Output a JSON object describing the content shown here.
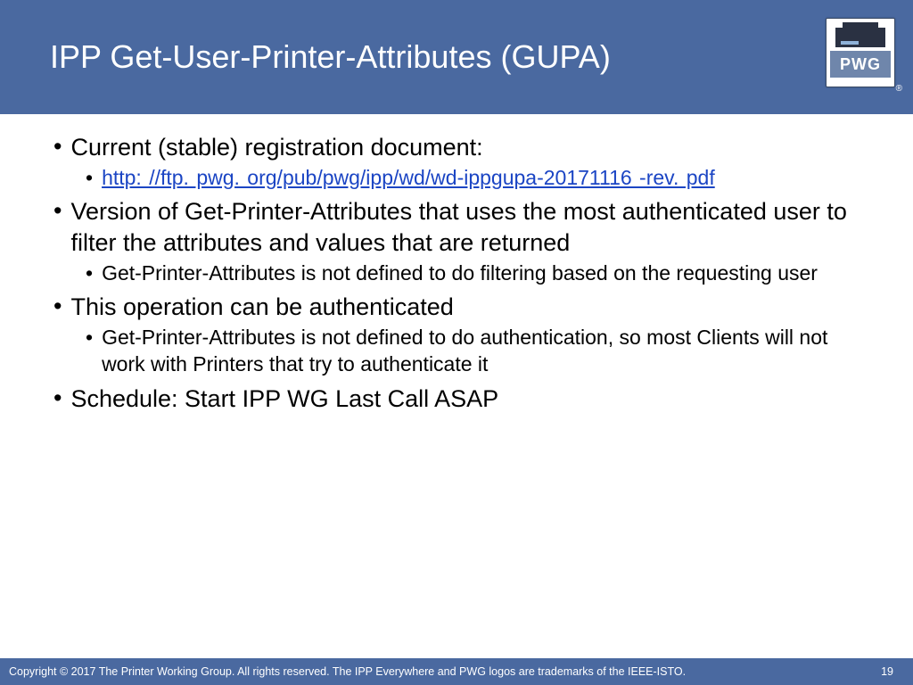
{
  "header": {
    "title": "IPP Get-User-Printer-Attributes (GUPA)",
    "logo_text": "PWG",
    "registered": "®"
  },
  "bullets": [
    {
      "text": "Current (stable) registration document:",
      "children": [
        {
          "text": "http: //ftp. pwg. org/pub/pwg/ipp/wd/wd-ippgupa-20171116 -rev. pdf",
          "link": true
        }
      ]
    },
    {
      "text": "Version of Get-Printer-Attributes that uses the most authenticated user to filter the attributes and values that are returned",
      "children": [
        {
          "text": "Get-Printer-Attributes is not defined to do filtering based on the requesting user"
        }
      ]
    },
    {
      "text": "This operation can be authenticated",
      "children": [
        {
          "text": "Get-Printer-Attributes is not defined to do authentication, so most Clients will not work with Printers that try to authenticate it"
        }
      ]
    },
    {
      "text": "Schedule: Start IPP WG Last Call ASAP",
      "children": []
    }
  ],
  "footer": {
    "copyright": "Copyright © 2017 The Printer Working Group. All rights reserved. The IPP Everywhere and PWG logos are trademarks of the IEEE-ISTO.",
    "page": "19"
  }
}
